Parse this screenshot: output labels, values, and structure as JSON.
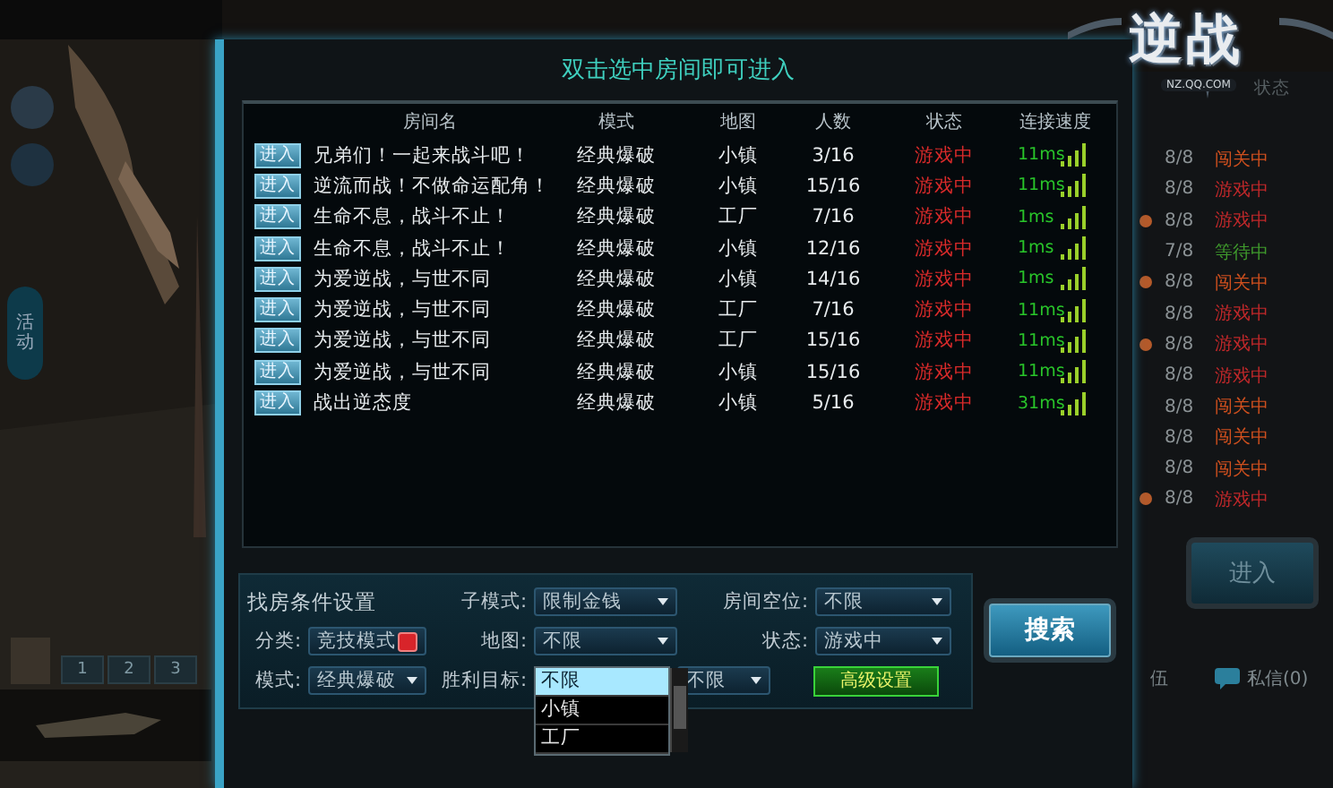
{
  "background": {
    "logo": {
      "title": "逆战",
      "site": "NZ.QQ.COM"
    },
    "side_button": "活动",
    "slots": [
      "1",
      "2",
      "3"
    ],
    "room_list": {
      "header": "状态",
      "rows": [
        {
          "count": "8/8",
          "status": "闯关中",
          "color": "#d0501e",
          "marked": false
        },
        {
          "count": "8/8",
          "status": "游戏中",
          "color": "#c0282a",
          "marked": false
        },
        {
          "count": "8/8",
          "status": "游戏中",
          "color": "#c0282a",
          "marked": true
        },
        {
          "count": "7/8",
          "status": "等待中",
          "color": "#3f9a2c",
          "marked": false
        },
        {
          "count": "8/8",
          "status": "闯关中",
          "color": "#d0501e",
          "marked": true
        },
        {
          "count": "8/8",
          "status": "游戏中",
          "color": "#c0282a",
          "marked": false
        },
        {
          "count": "8/8",
          "status": "游戏中",
          "color": "#c0282a",
          "marked": true
        },
        {
          "count": "8/8",
          "status": "游戏中",
          "color": "#c0282a",
          "marked": false
        },
        {
          "count": "8/8",
          "status": "闯关中",
          "color": "#d0501e",
          "marked": false
        },
        {
          "count": "8/8",
          "status": "闯关中",
          "color": "#d0501e",
          "marked": false
        },
        {
          "count": "8/8",
          "status": "闯关中",
          "color": "#d0501e",
          "marked": false
        },
        {
          "count": "8/8",
          "status": "游戏中",
          "color": "#c0282a",
          "marked": true
        }
      ]
    },
    "enter_button": "进入",
    "team_tab": "伍",
    "messages": "私信(0)"
  },
  "dialog": {
    "title": "双击选中房间即可进入",
    "columns": [
      "房间名",
      "模式",
      "地图",
      "人数",
      "状态",
      "连接速度"
    ],
    "rows": [
      {
        "join": "进入",
        "name": "兄弟们！一起来战斗吧！",
        "mode": "经典爆破",
        "map": "小镇",
        "players": "3/16",
        "status": "游戏中",
        "ping": "11ms"
      },
      {
        "join": "进入",
        "name": "逆流而战！不做命运配角！",
        "mode": "经典爆破",
        "map": "小镇",
        "players": "15/16",
        "status": "游戏中",
        "ping": "11ms"
      },
      {
        "join": "进入",
        "name": "生命不息，战斗不止！",
        "mode": "经典爆破",
        "map": "工厂",
        "players": "7/16",
        "status": "游戏中",
        "ping": "1ms"
      },
      {
        "join": "进入",
        "name": "生命不息，战斗不止！",
        "mode": "经典爆破",
        "map": "小镇",
        "players": "12/16",
        "status": "游戏中",
        "ping": "1ms"
      },
      {
        "join": "进入",
        "name": "为爱逆战，与世不同",
        "mode": "经典爆破",
        "map": "小镇",
        "players": "14/16",
        "status": "游戏中",
        "ping": "1ms"
      },
      {
        "join": "进入",
        "name": "为爱逆战，与世不同",
        "mode": "经典爆破",
        "map": "工厂",
        "players": "7/16",
        "status": "游戏中",
        "ping": "11ms"
      },
      {
        "join": "进入",
        "name": "为爱逆战，与世不同",
        "mode": "经典爆破",
        "map": "工厂",
        "players": "15/16",
        "status": "游戏中",
        "ping": "11ms"
      },
      {
        "join": "进入",
        "name": "为爱逆战，与世不同",
        "mode": "经典爆破",
        "map": "小镇",
        "players": "15/16",
        "status": "游戏中",
        "ping": "11ms"
      },
      {
        "join": "进入",
        "name": "战出逆态度",
        "mode": "经典爆破",
        "map": "小镇",
        "players": "5/16",
        "status": "游戏中",
        "ping": "31ms"
      }
    ],
    "filters": [
      [
        {
          "kind": "heading",
          "text": "找房条件设置"
        },
        {
          "kind": "select",
          "label": "子模式:",
          "value": "限制金钱"
        },
        {
          "kind": "select",
          "label": "房间空位:",
          "value": "不限"
        }
      ],
      [
        {
          "kind": "tag",
          "label": "分类:",
          "value": "竞技模式"
        },
        {
          "kind": "select",
          "label": "地图:",
          "value": "不限"
        },
        {
          "kind": "select",
          "label": "状态:",
          "value": "游戏中"
        }
      ],
      [
        {
          "kind": "select",
          "label": "模式:",
          "value": "经典爆破"
        },
        {
          "kind": "select",
          "label": "胜利目标:",
          "expanded": true,
          "options": [
            {
              "label": "不限",
              "selected": true
            },
            {
              "label": "小镇",
              "selected": false
            },
            {
              "label": "工厂",
              "selected": false
            }
          ]
        },
        {
          "kind": "select",
          "value": "不限"
        },
        {
          "kind": "button",
          "text": "高级设置"
        }
      ]
    ],
    "search_button": "搜索"
  }
}
